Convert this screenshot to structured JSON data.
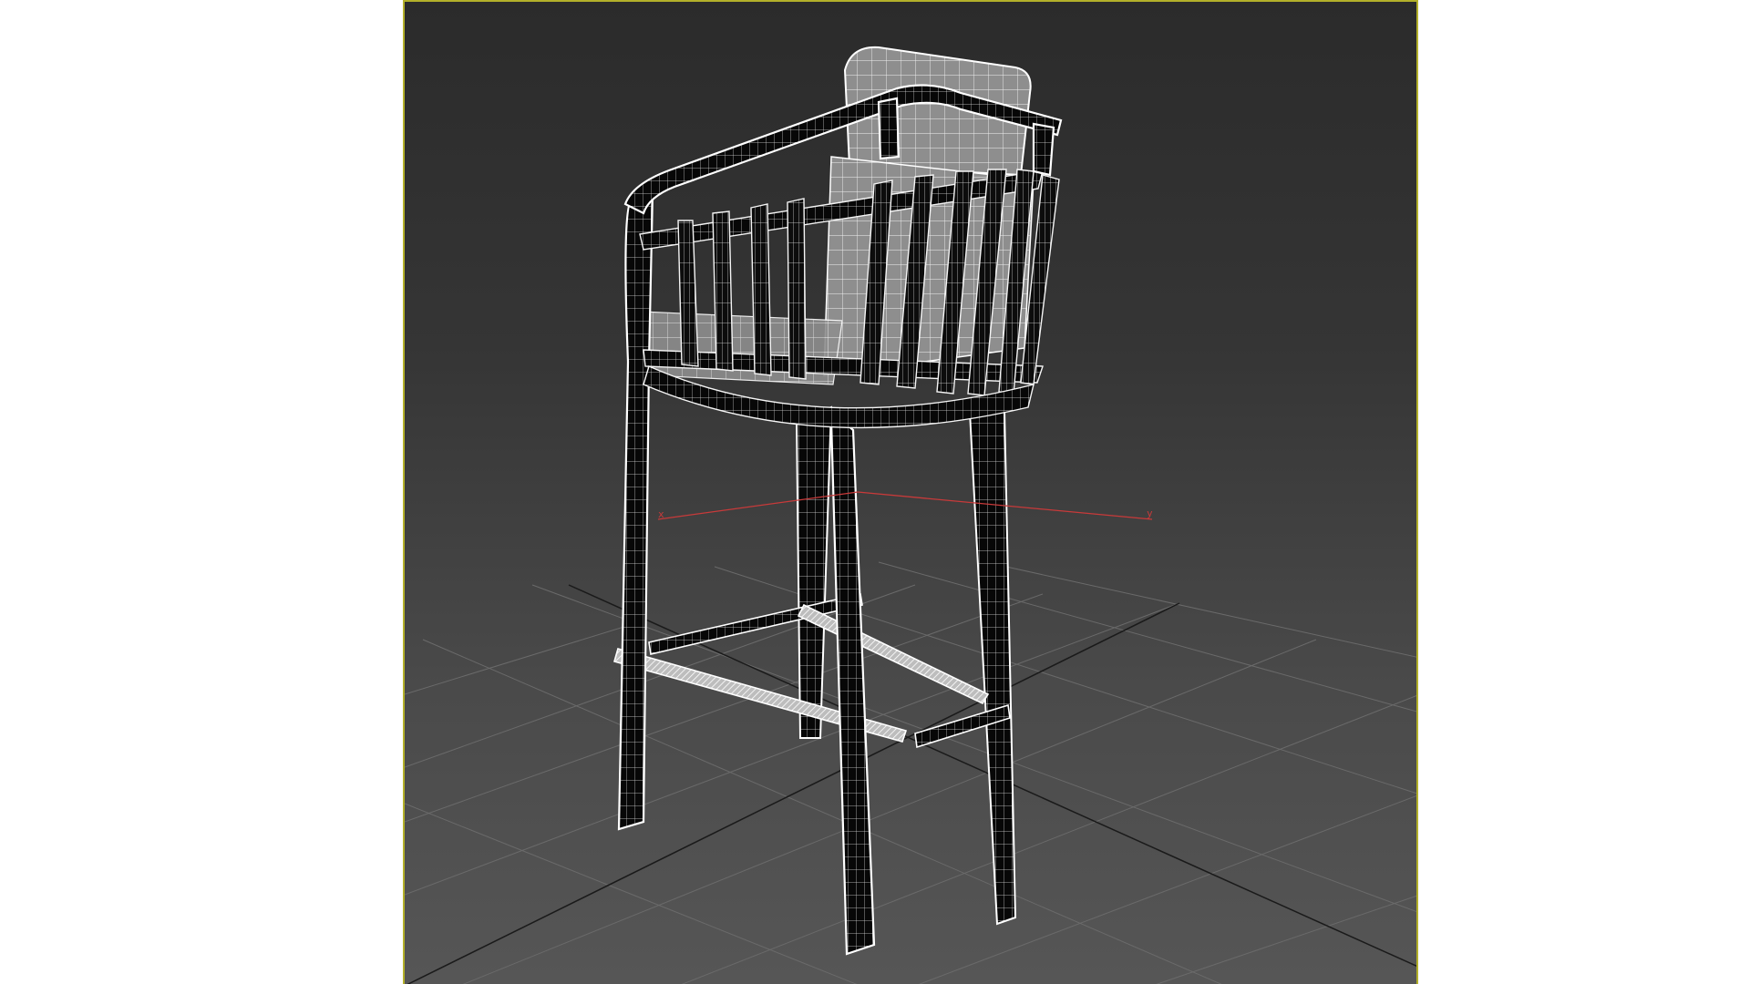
{
  "viewport": {
    "border_color": "#b3b02a",
    "background_top": "#2b2b2b",
    "background_bottom": "#565656"
  },
  "gizmo": {
    "x_label": "x",
    "y_label": "y",
    "color": "#c83a3a"
  },
  "model": {
    "name_icon": "bar-stool-wireframe",
    "wire_color": "#ffffff",
    "solid_color": "#050505",
    "cushion_color": "#8a8a8a"
  }
}
